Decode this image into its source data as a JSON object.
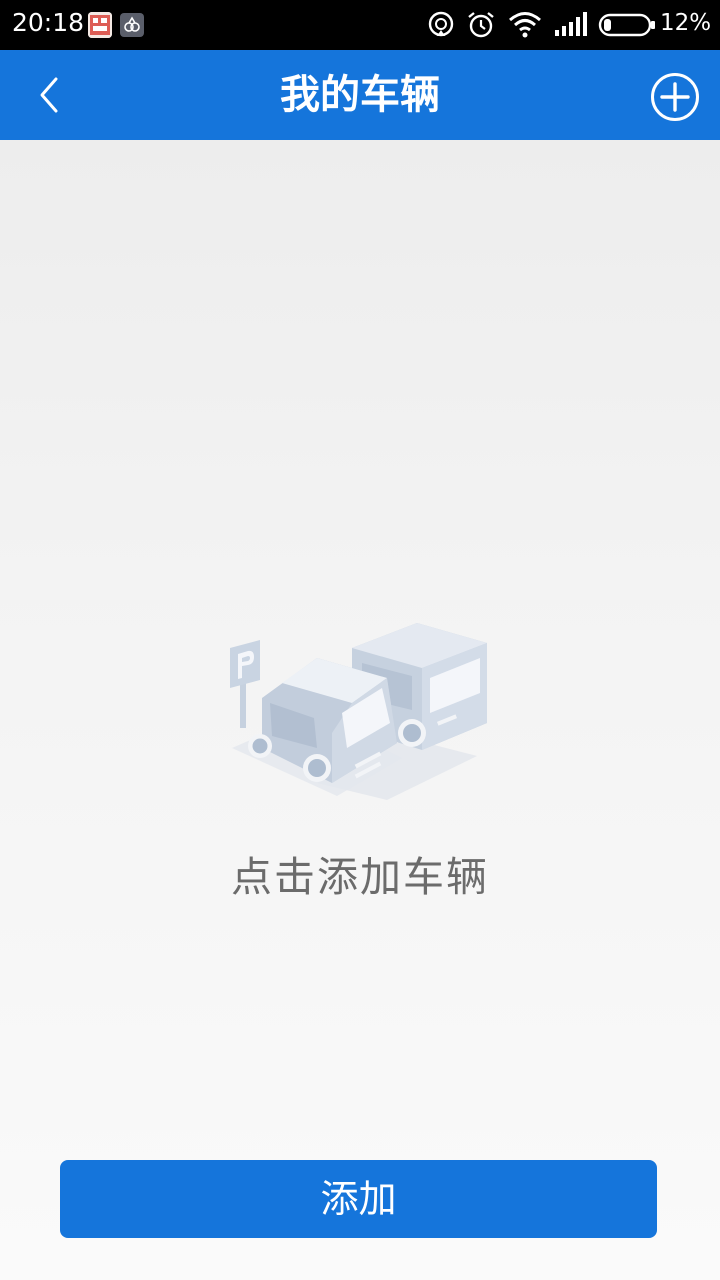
{
  "status_bar": {
    "time": "20:18",
    "battery_percent": "12%",
    "icons": [
      "app-notification-icon",
      "gallery-notification-icon",
      "sync-icon",
      "alarm-icon",
      "wifi-icon",
      "signal-icon",
      "battery-icon"
    ]
  },
  "header": {
    "title": "我的车辆",
    "back_icon": "chevron-left-icon",
    "add_icon": "plus-circle-icon"
  },
  "empty_state": {
    "illustration": "parked-cars-illustration",
    "message": "点击添加车辆"
  },
  "footer": {
    "add_label": "添加"
  },
  "colors": {
    "primary": "#1575db",
    "status_bar": "#000000",
    "empty_text": "#6b6b6b",
    "illustration": "#c9d4e2"
  }
}
